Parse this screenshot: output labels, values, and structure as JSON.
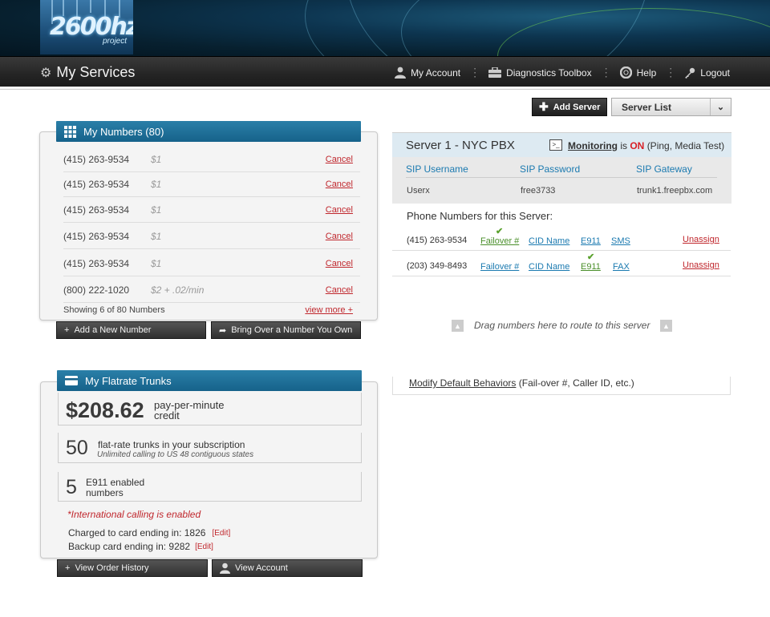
{
  "header": {
    "logo_text": "2600hz",
    "logo_sub": "project",
    "page_title": "My Services",
    "nav": {
      "my_account": "My Account",
      "diagnostics": "Diagnostics Toolbox",
      "help": "Help",
      "logout": "Logout"
    }
  },
  "numbers_panel": {
    "title": "My Numbers (80)",
    "rows": [
      {
        "phone": "(415) 263-9534",
        "price": "$1",
        "action": "Cancel"
      },
      {
        "phone": "(415) 263-9534",
        "price": "$1",
        "action": "Cancel"
      },
      {
        "phone": "(415) 263-9534",
        "price": "$1",
        "action": "Cancel"
      },
      {
        "phone": "(415) 263-9534",
        "price": "$1",
        "action": "Cancel"
      },
      {
        "phone": "(415) 263-9534",
        "price": "$1",
        "action": "Cancel"
      },
      {
        "phone": "(800) 222-1020",
        "price": "$2 + .02/min",
        "action": "Cancel"
      }
    ],
    "showing": "Showing 6 of 80 Numbers",
    "view_more": "view more +",
    "add_button": "Add a New Number",
    "bring_button": "Bring Over a Number You Own"
  },
  "trunks_panel": {
    "title": "My Flatrate Trunks",
    "credit_value": "$208.62",
    "credit_line1": "pay-per-minute",
    "credit_line2": "credit",
    "trunks_value": "50",
    "trunks_label": "flat-rate trunks in your subscription",
    "trunks_sub": "Unlimited calling to US 48 contiguous states",
    "e911_value": "5",
    "e911_line1": "E911 enabled",
    "e911_line2": "numbers",
    "intl_notice": "*International calling is enabled",
    "charged_label": "Charged to card ending in: 1826",
    "backup_label": "Backup card ending in: 9282",
    "edit_label": "[Edit]",
    "order_history_button": "View Order History",
    "view_account_button": "View Account"
  },
  "server_controls": {
    "add_server": "Add Server",
    "server_list": "Server List"
  },
  "server": {
    "name": "Server 1 - NYC PBX",
    "monitoring_label": "Monitoring",
    "monitoring_is": "is",
    "monitoring_state": "ON",
    "monitoring_detail": "(Ping, Media Test)",
    "sip_username_label": "SIP Username",
    "sip_password_label": "SIP Password",
    "sip_gateway_label": "SIP Gateway",
    "sip_username": "Userx",
    "sip_password": "free3733",
    "sip_gateway": "trunk1.freepbx.com",
    "phone_numbers_title": "Phone Numbers for this Server:",
    "numbers": [
      {
        "phone": "(415) 263-9534",
        "failover": "Failover #",
        "cid": "CID Name",
        "e911": "E911",
        "extra": "SMS",
        "unassign": "Unassign"
      },
      {
        "phone": "(203) 349-8493",
        "failover": "Failover #",
        "cid": "CID Name",
        "e911": "E911",
        "extra": "FAX",
        "unassign": "Unassign"
      }
    ],
    "drag_hint": "Drag numbers here to route to this server",
    "modify_link": "Modify Default Behaviors",
    "modify_detail": "(Fail-over #, Caller ID, etc.)"
  },
  "colors": {
    "accent_blue": "#16628a",
    "link_blue": "#1b7ab0",
    "cancel_red": "#c0272d",
    "check_green": "#5aa12d"
  }
}
